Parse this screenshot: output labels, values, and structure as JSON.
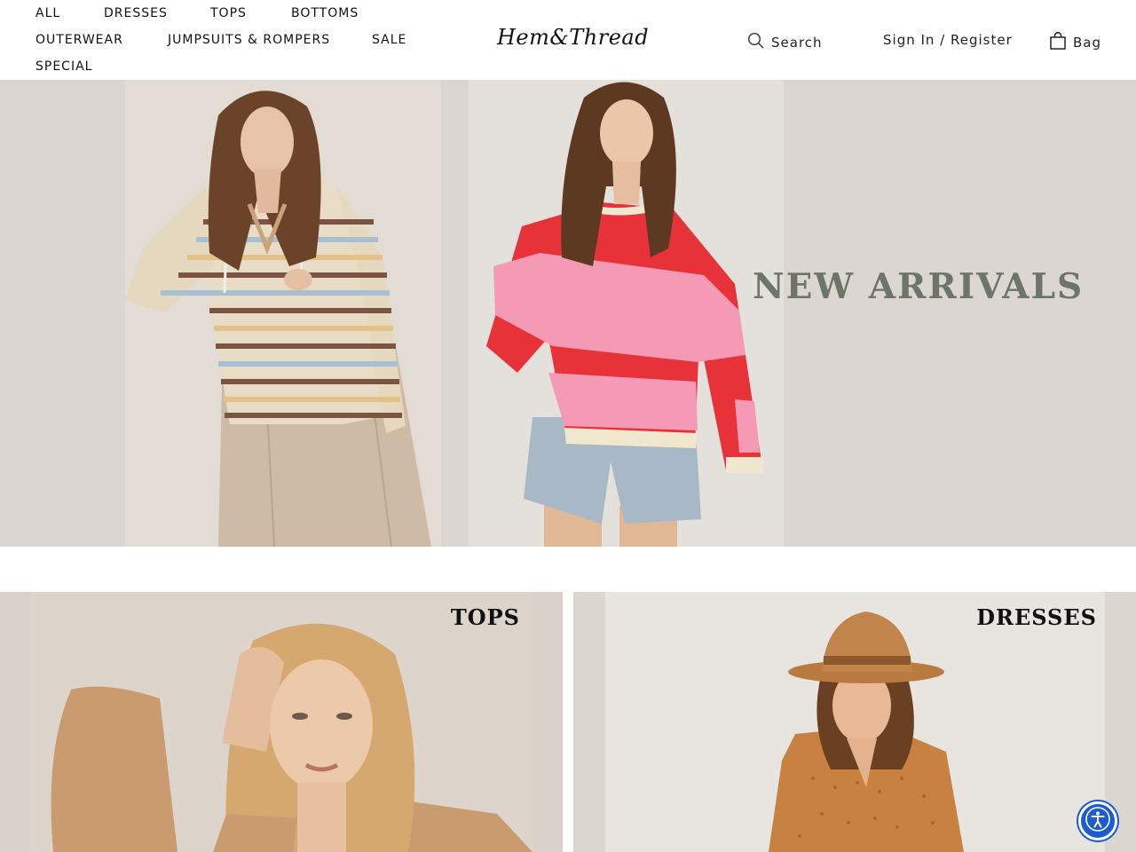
{
  "nav": {
    "all": "ALL",
    "dresses": "DRESSES",
    "tops": "TOPS",
    "bottoms": "BOTTOMS",
    "outerwear": "OUTERWEAR",
    "jumpsuits": "JUMPSUITS & ROMPERS",
    "sale": "SALE",
    "special": "SPECIAL"
  },
  "brand": {
    "logo_text": "Hem&Thread"
  },
  "header_actions": {
    "search_label": "Search",
    "search_icon": "search-icon",
    "signin_label": "Sign In / Register",
    "bag_label": "Bag",
    "bag_icon": "shopping-bag-icon"
  },
  "hero": {
    "title": "NEW ARRIVALS",
    "title_color": "#6c7567",
    "background_color": "#dcd6d2"
  },
  "categories": [
    {
      "label": "TOPS",
      "background_color": "#dbd1cb"
    },
    {
      "label": "DRESSES",
      "background_color": "#dcd6d1"
    }
  ],
  "accessibility": {
    "icon": "accessibility-icon",
    "color": "#1d5bd1"
  }
}
